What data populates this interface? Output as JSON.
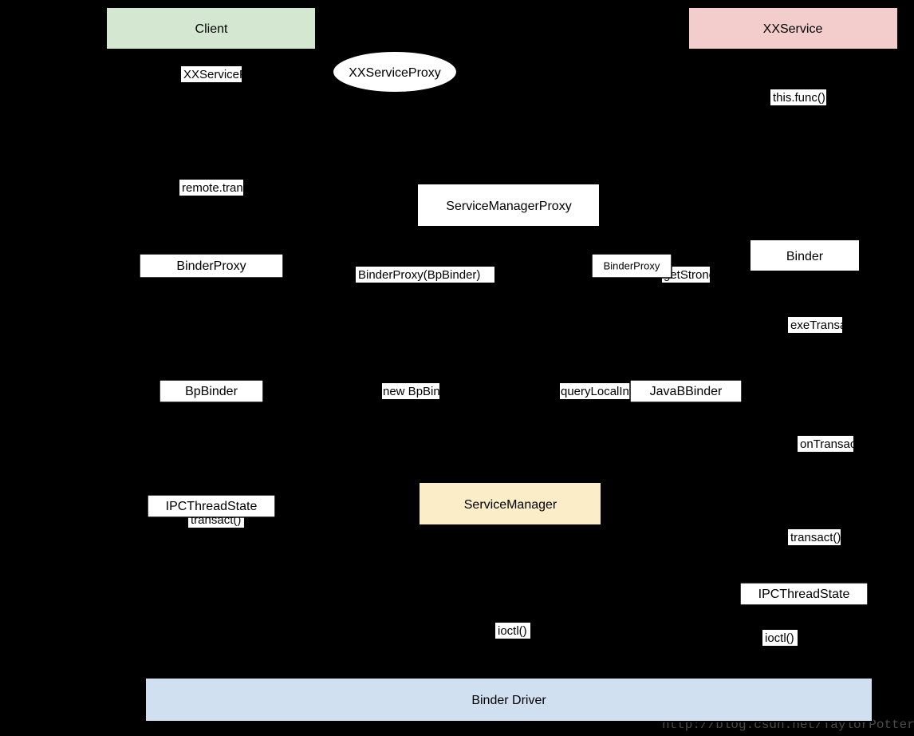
{
  "nodes": {
    "client": {
      "label": "Client"
    },
    "xxservice": {
      "label": "XXService"
    },
    "xxserviceproxy": {
      "label": "XXServiceProxy"
    },
    "binderproxy_top": {
      "label": "BinderProxy"
    },
    "servicemanagerproxy": {
      "label": "ServiceManagerProxy"
    },
    "binderproxy_mid": {
      "label": "BinderProxy(BpBinder)"
    },
    "binder": {
      "label": "Binder"
    },
    "bpbinder": {
      "label": "BpBinder"
    },
    "javabbinder": {
      "label": "JavaBBinder"
    },
    "ipcthreadstate_l": {
      "label": "IPCThreadState"
    },
    "servicemanager": {
      "label": "ServiceManager"
    },
    "ipcthreadstate_r": {
      "label": "IPCThreadState"
    },
    "binderdriver": {
      "label": "Binder Driver"
    }
  },
  "edges": {
    "client_proxy": {
      "label": "XXServiceProxy.func()"
    },
    "proxy_top": {
      "label": "remote.transact()"
    },
    "bpmid_label": {
      "label": "BinderProxy(BpBinder)"
    },
    "bpmid_bp": {
      "label": "transact()"
    },
    "bp_ipc": {
      "label": "transact()"
    },
    "ipc_driver_l": {
      "label": "ioctl()"
    },
    "ipc_driver_r": {
      "label": "ioctl()"
    },
    "new_bpbinder": {
      "label": "new BpBinder(handle)"
    },
    "binder_javab": {
      "label": "queryLocalInterface|JavaBBinder"
    },
    "getstrong": {
      "label": "getStrongBinder"
    },
    "ipc_r_javab": {
      "label": "transact()"
    },
    "javab_binder": {
      "label": "onTransact()"
    },
    "binder_xxservice": {
      "label": "exeTransact()"
    },
    "xxservice_self": {
      "label": "this.func()"
    }
  },
  "watermark": "http://blog.csdn.net/TaylorPotter"
}
